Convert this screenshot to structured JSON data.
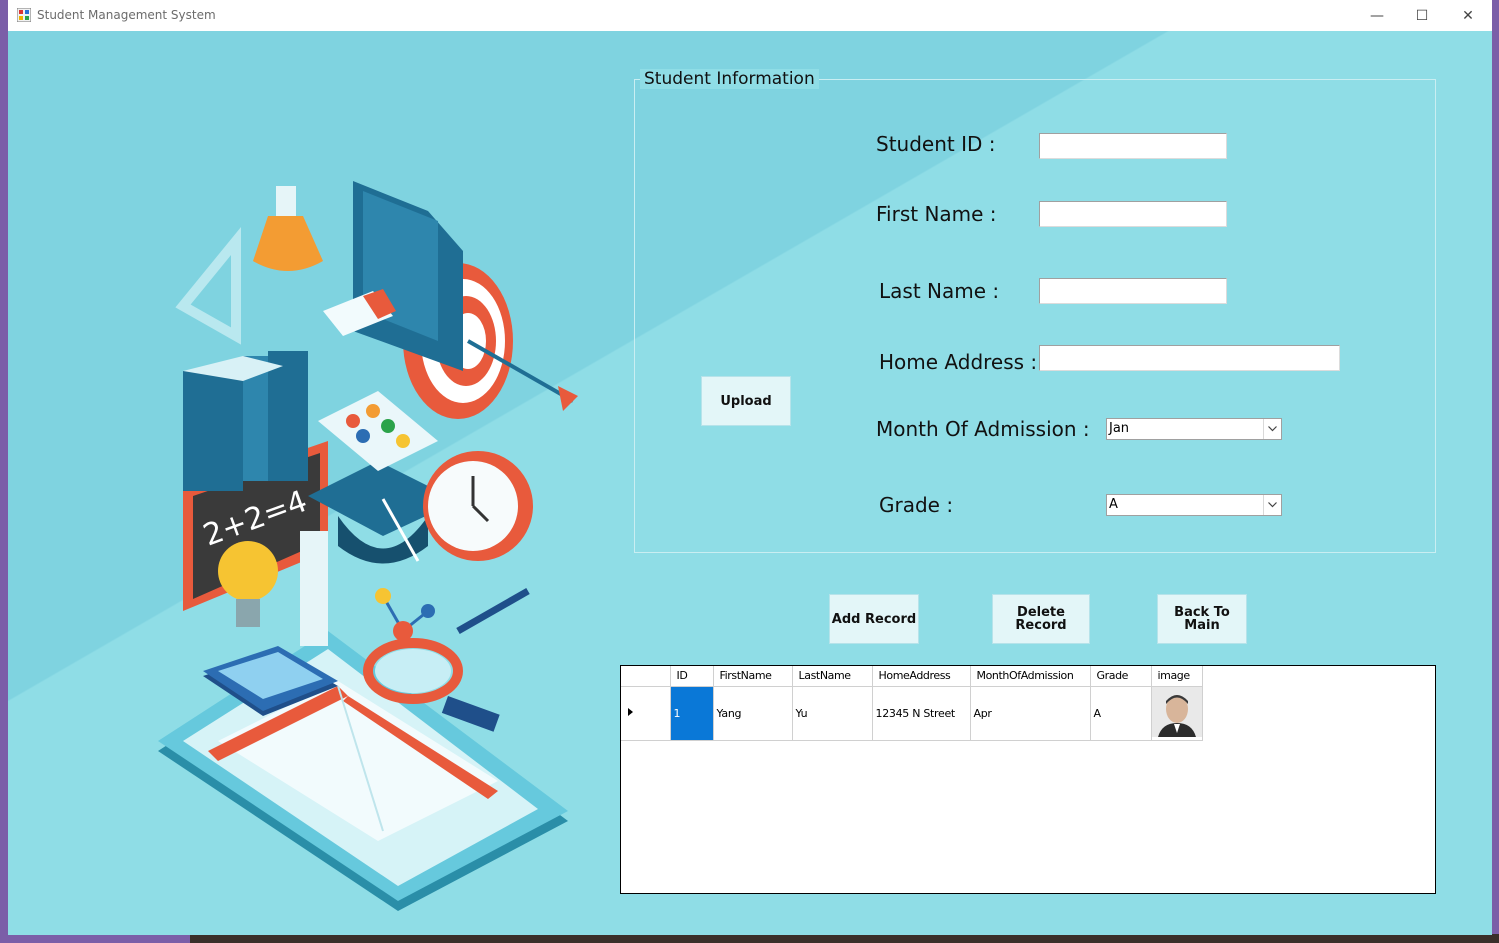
{
  "window": {
    "title": "Student Management System",
    "controls": {
      "minimize": "—",
      "maximize": "☐",
      "close": "✕"
    }
  },
  "form": {
    "group_title": "Student Information",
    "labels": {
      "student_id": "Student ID :",
      "first_name": "First Name :",
      "last_name": "Last Name :",
      "home_address": "Home Address :",
      "month_of_admission": "Month Of Admission :",
      "grade": "Grade :"
    },
    "values": {
      "student_id": "",
      "first_name": "",
      "last_name": "",
      "home_address": "",
      "month_of_admission": "Jan",
      "grade": "A"
    },
    "upload_button": "Upload"
  },
  "actions": {
    "add_record": "Add Record",
    "delete_record": "Delete Record",
    "back_to_main_line1": "Back To",
    "back_to_main_line2": "Main"
  },
  "table": {
    "columns": [
      "ID",
      "FirstName",
      "LastName",
      "HomeAddress",
      "MonthOfAdmission",
      "Grade",
      "image"
    ],
    "rows": [
      {
        "id": "1",
        "first_name": "Yang",
        "last_name": "Yu",
        "home_address": "12345 N Street",
        "month": "Apr",
        "grade": "A",
        "image": "student-photo"
      }
    ]
  },
  "colors": {
    "background": "#8adbe4",
    "selected_cell": "#0a78d7",
    "button_bg": "#e3f6f8"
  }
}
